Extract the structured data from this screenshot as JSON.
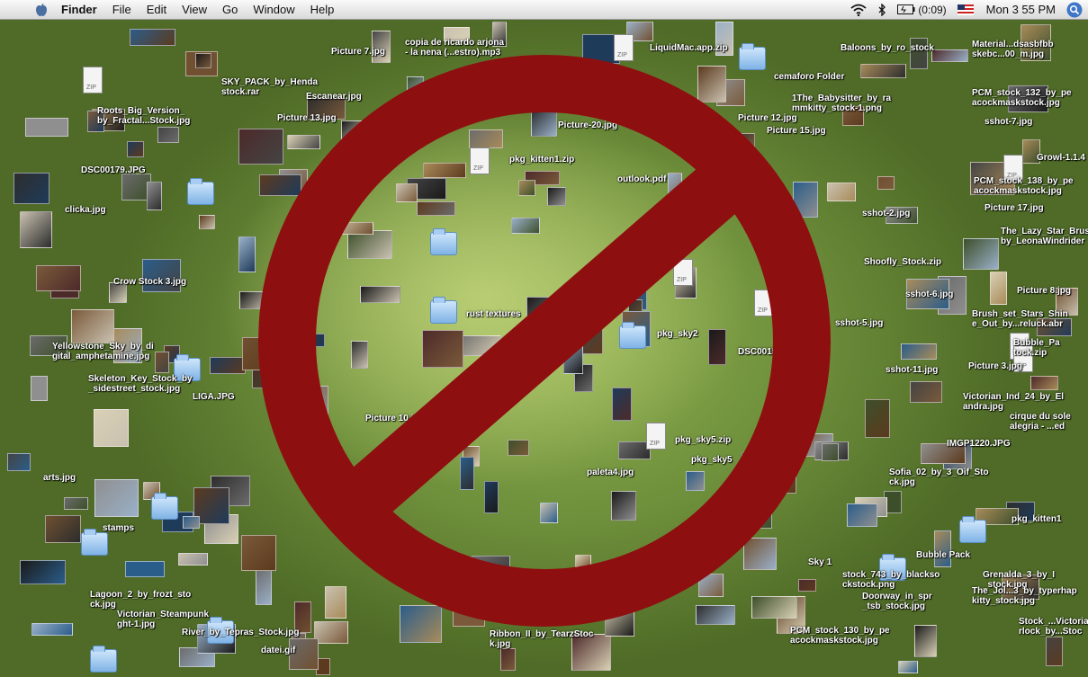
{
  "menubar": {
    "app_name": "Finder",
    "menus": [
      "File",
      "Edit",
      "View",
      "Go",
      "Window",
      "Help"
    ],
    "battery": "(0:09)",
    "clock": "Mon 3 55 PM"
  },
  "desktop": {
    "labels": [
      "Picture 7.jpg",
      "copia de ricardo arjona\n- la nena (...estro).mp3",
      "LiquidMac.app.zip",
      "Baloons_by_ro_stock",
      "Material...dsasbfbb\nskebc...00_m.jpg",
      "cemaforo Folder",
      "1The_Babysitter_by_ra\nmmkitty_stock-1.png",
      "PCM_stock_132_by_pe\nacockmaskstock.jpg",
      "SKY_PACK_by_Henda\nstock.rar",
      "Escanear.jpg",
      "Picture 13.jpg",
      "Picture 12.jpg",
      "Picture 15.jpg",
      "sshot-7.jpg",
      "Roots_Big_Version_\nby_Fractal...Stock.jpg",
      "DSC00179.JPG",
      "pkg_kitten1.zip",
      "Picture-20.jpg",
      "outlook.pdf",
      "Growl-1.1.4",
      "PCM_stock_138_by_pe\nacockmaskstock.jpg",
      "Picture 17.jpg",
      "clicka.jpg",
      "sshot-2.jpg",
      "The_Lazy_Star_Brus\nby_LeonaWindrider",
      "Shoofly_Stock.zip",
      "Picture 8.jpg",
      "Crow Stock 3.jpg",
      "Brush_set_Stars_Shin\ne_Out_by...reluck.abr",
      "sshot-5.jpg",
      "rust textures",
      "sshot-6.jpg",
      "Yellowstone_Sky_by_di\ngital_amphetamine.jpg",
      "Bubble_Pa\ntock.zip",
      "pkg_sky2",
      "DSC0015",
      "sshot-11.jpg",
      "Picture 3.jpg",
      "Skeleton_Key_Stock_by\n_sidestreet_stock.jpg",
      "LIGA.JPG",
      "Victorian_Ind_24_by_El\nandra.jpg",
      "cirque du sole\nalegria - ...ed",
      "Picture 10.jpg",
      "pkg_sky5.zip",
      "IMGP1220.JPG",
      "arts.jpg",
      "pkg_sky5",
      "paleta4.jpg",
      "Sofia_02_by_3_Oif_Sto\nck.jpg",
      "stamps",
      "pkg_kitten1",
      "Bubble Pack",
      "Grenalda_3_by_I\n_stock.jpg",
      "Sky 1",
      "stock_743_by_blackso\nckstock.png",
      "Doorway_in_spr\n_tsb_stock.jpg",
      "The_Jol...3_by_typerhap\nkitty_stock.jpg",
      "Lagoon_2_by_frozt_sto\nck.jpg",
      "Victorian_Steampunk\nght-1.jpg",
      "River_by_Tepras_Stock.jpg",
      "datei.gif",
      "Ribbon_II_by_TearzStoc\nk.jpg",
      "PCM_stock_130_by_pe\nacockmaskstock.jpg",
      "Stock_...Victoria\nrlock_by...Stoc"
    ]
  },
  "colors": {
    "no_sign": "#8e0f10",
    "desktop_light": "#b9cd74",
    "desktop_dark": "#4f6b27"
  }
}
